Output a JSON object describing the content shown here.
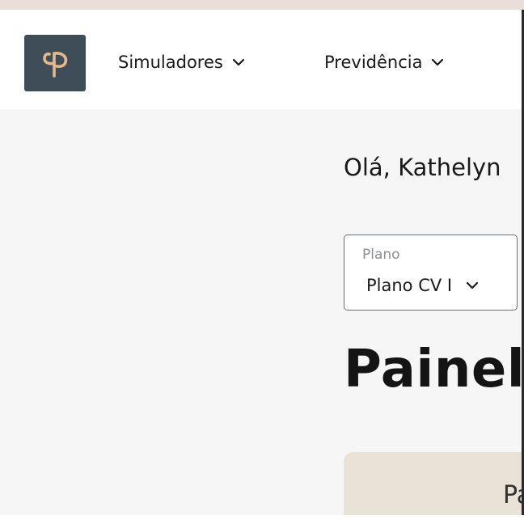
{
  "header": {
    "logo_icon": "leaf-sprout-icon",
    "logo_colors": {
      "background": "#3f4d59",
      "mark": "#e2b98d"
    },
    "nav": [
      {
        "label": "Simuladores",
        "icon": "chevron-down-icon"
      },
      {
        "label": "Previdência",
        "icon": "chevron-down-icon"
      }
    ]
  },
  "main": {
    "greeting": "Olá, Kathelyn",
    "plan_select": {
      "label": "Plano",
      "value": "Plano CV I",
      "icon": "chevron-down-icon"
    },
    "title": "Painel",
    "card": {
      "text": "Pa",
      "background": "#e8e3d6"
    }
  }
}
